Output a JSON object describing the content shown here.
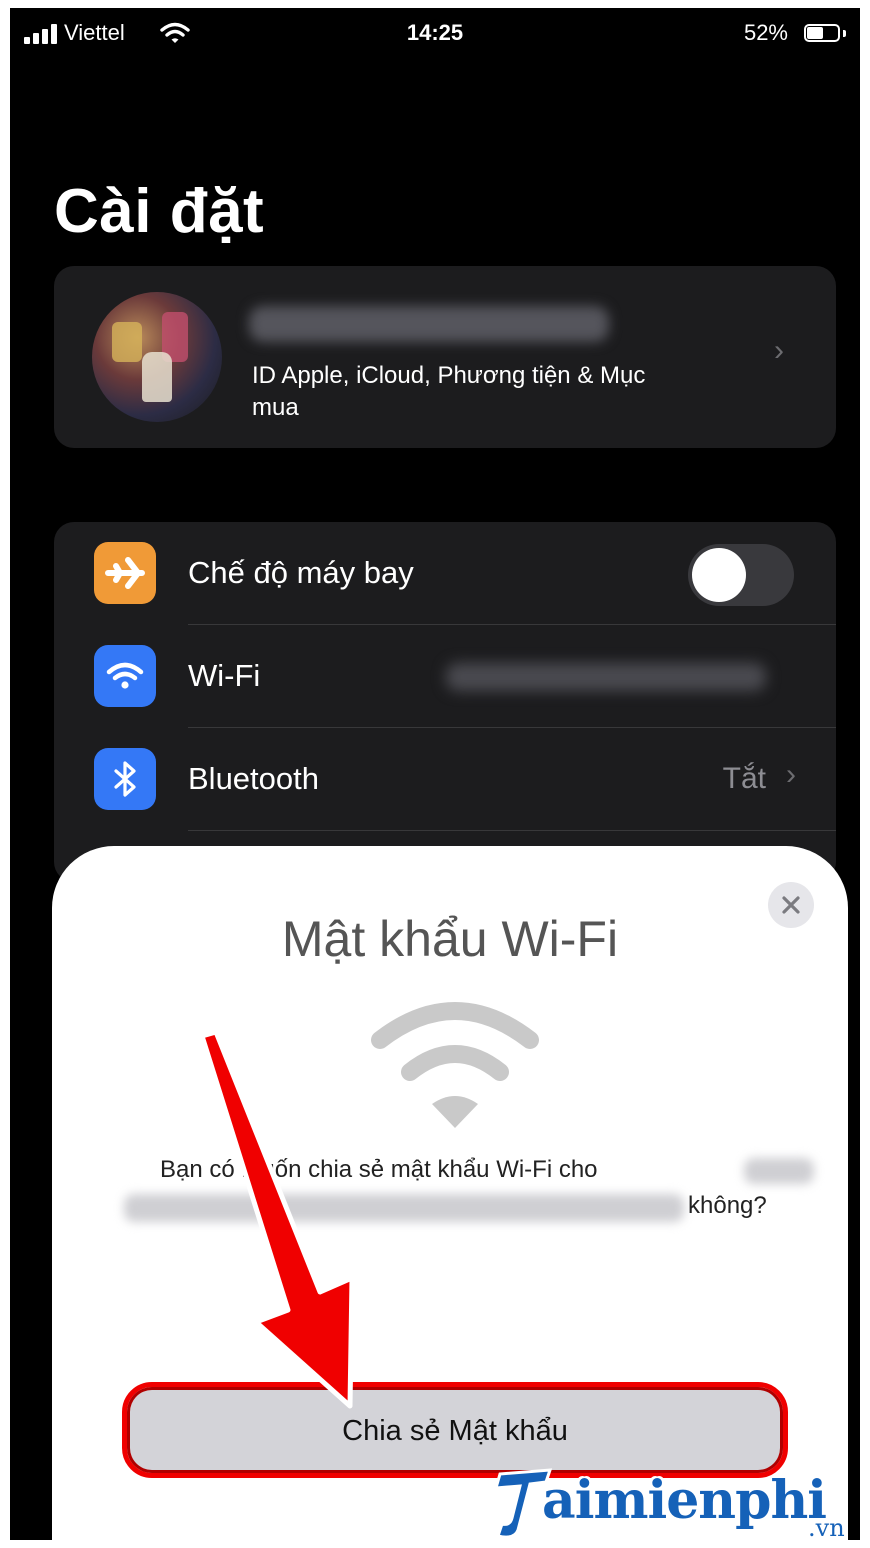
{
  "status_bar": {
    "carrier": "Viettel",
    "time": "14:25",
    "battery_percent": "52%",
    "battery_level": 0.52,
    "signal_bars": 4
  },
  "page_title": "Cài đặt",
  "profile": {
    "subtitle": "ID Apple, iCloud, Phương tiện & Mục mua"
  },
  "settings": {
    "airplane": {
      "label": "Chế độ máy bay",
      "toggle_on": false,
      "icon": "airplane-icon",
      "color": "#f09a37"
    },
    "wifi": {
      "label": "Wi-Fi",
      "icon": "wifi-icon",
      "color": "#3478f6"
    },
    "bluetooth": {
      "label": "Bluetooth",
      "value": "Tắt",
      "icon": "bluetooth-icon",
      "color": "#3478f6"
    }
  },
  "sheet": {
    "title": "Mật khẩu Wi-Fi",
    "question_part1": "Bạn có muốn chia sẻ mật khẩu Wi-Fi cho",
    "question_part2": "không?",
    "share_button": "Chia sẻ Mật khẩu",
    "highlight_color": "#f00000"
  },
  "watermark": {
    "word": "aimienphi",
    "tld": ".vn",
    "color": "#1561b8"
  }
}
